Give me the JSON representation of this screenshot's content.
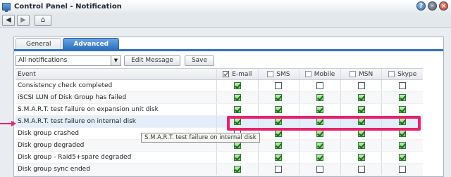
{
  "window": {
    "title": "Control Panel - Notification"
  },
  "toolbar": {
    "back_icon": "arrow-left",
    "forward_icon": "arrow-right",
    "home_icon": "home"
  },
  "tabs": [
    {
      "label": "General",
      "active": false
    },
    {
      "label": "Advanced",
      "active": true
    }
  ],
  "controls": {
    "filter_value": "All notifications",
    "edit_message_label": "Edit Message",
    "save_label": "Save"
  },
  "table": {
    "columns": [
      "Event",
      "E-mail",
      "SMS",
      "Mobile",
      "MSN",
      "Skype"
    ],
    "header_checked": [
      true,
      false,
      false,
      false,
      false
    ],
    "rows": [
      {
        "event": "Consistency check completed",
        "checks": [
          true,
          false,
          false,
          false,
          false
        ]
      },
      {
        "event": "iSCSI LUN of Disk Group has failed",
        "checks": [
          true,
          true,
          true,
          true,
          true
        ]
      },
      {
        "event": "S.M.A.R.T. test failure on expansion unit disk",
        "checks": [
          true,
          true,
          true,
          true,
          true
        ]
      },
      {
        "event": "S.M.A.R.T. test failure on internal disk",
        "checks": [
          true,
          true,
          true,
          true,
          true
        ]
      },
      {
        "event": "Disk group crashed",
        "checks": [
          false,
          true,
          true,
          true,
          true
        ]
      },
      {
        "event": "Disk group degraded",
        "checks": [
          true,
          true,
          true,
          true,
          true
        ]
      },
      {
        "event": "Disk group - Raid5+spare degraded",
        "checks": [
          true,
          true,
          true,
          true,
          true
        ]
      },
      {
        "event": "Disk group sync ended",
        "checks": [
          true,
          false,
          false,
          false,
          false
        ]
      }
    ]
  },
  "tooltip": {
    "text": "S.M.A.R.T. test failure on internal disk"
  },
  "colors": {
    "accent": "#2f71bf",
    "annotation": "#e8226a",
    "check_green": "#1a6a1a"
  }
}
